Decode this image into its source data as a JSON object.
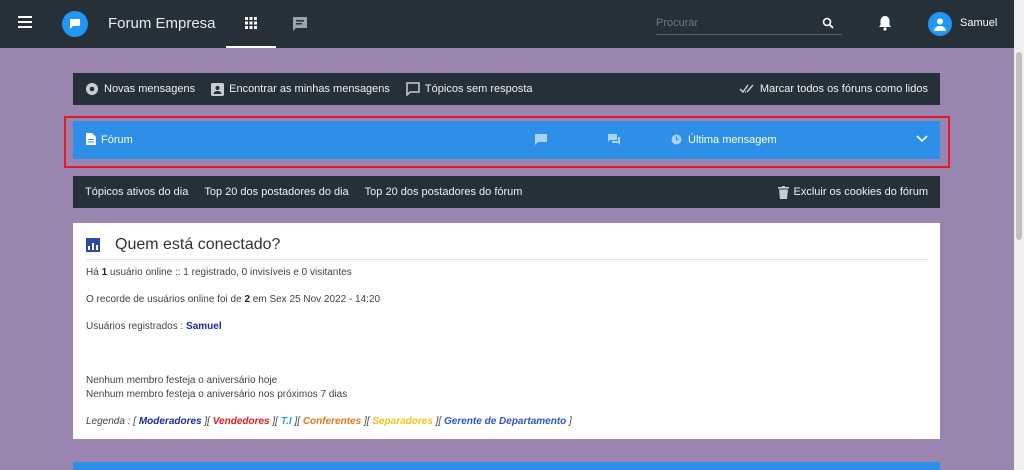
{
  "topbar": {
    "site_title": "Forum Empresa",
    "search_placeholder": "Procurar",
    "username": "Samuel"
  },
  "toolbar": {
    "items": [
      {
        "label": "Novas mensagens",
        "icon": "gear-icon"
      },
      {
        "label": "Encontrar as minhas mensagens",
        "icon": "user-card-icon"
      },
      {
        "label": "Tópicos sem resposta",
        "icon": "chat-bubble-icon"
      }
    ],
    "mark_read": "Marcar todos os fóruns como lidos"
  },
  "forum_header": {
    "forum_label": "Fórum",
    "last_post_label": "Última mensagem"
  },
  "secondary_bar": {
    "items": [
      "Tópicos ativos do dia",
      "Top 20 dos postadores do dia",
      "Top 20 dos postadores do fórum"
    ],
    "delete_cookies": "Excluir os cookies do fórum"
  },
  "who_online": {
    "title": "Quem está conectado?",
    "line1_pre": "Há ",
    "line1_count": "1",
    "line1_post": " usuário online :: 1 registrado, 0 invisíveis e 0 visitantes",
    "line2_pre": "O recorde de usuários online foi de ",
    "line2_count": "2",
    "line2_post": " em Sex 25 Nov 2022 - 14:20",
    "registered_label": "Usuários registrados : ",
    "registered_user": "Samuel",
    "birthday_today": "Nenhum membro festeja o aniversário hoje",
    "birthday_week": "Nenhum membro festeja o aniversário nos próximos 7 dias",
    "legend_label": "Legenda : [ ",
    "groups": [
      {
        "name": "Moderadores",
        "color": "#1a2a9c"
      },
      {
        "name": "Vendedores",
        "color": "#e31b23"
      },
      {
        "name": "T.I",
        "color": "#29a3d9"
      },
      {
        "name": "Conferentes",
        "color": "#e07a1f"
      },
      {
        "name": "Separadores",
        "color": "#f2c21a"
      },
      {
        "name": "Gerente de Departamento",
        "color": "#3352c9"
      }
    ]
  },
  "colors": {
    "topbar": "#263038",
    "background": "#9a84b0",
    "accent_blue": "#2d8fe8",
    "highlight_red": "#e31b23"
  }
}
